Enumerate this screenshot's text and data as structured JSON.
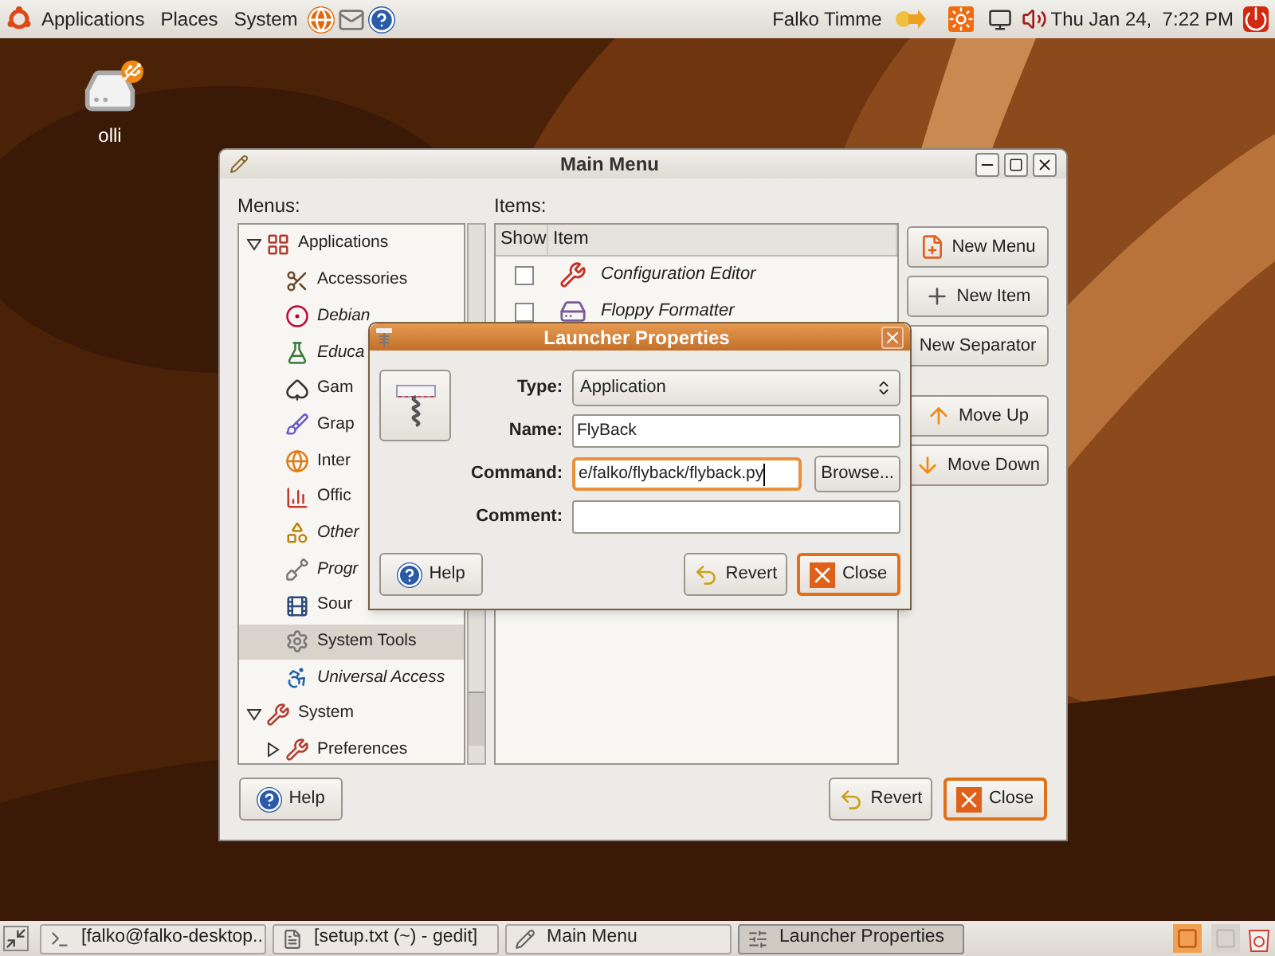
{
  "top_panel": {
    "menus": [
      {
        "label": "Applications"
      },
      {
        "label": "Places"
      },
      {
        "label": "System"
      }
    ],
    "user": "Falko Timme",
    "clock": "Thu Jan 24,  7:22 PM"
  },
  "desktop_icons": [
    {
      "label": "olli"
    }
  ],
  "main_menu": {
    "title": "Main Menu",
    "menus_label": "Menus:",
    "items_label": "Items:",
    "tree": [
      {
        "label": "Applications",
        "expanded": true,
        "selected": false,
        "hidden": false,
        "children": [
          {
            "label": "Accessories",
            "selected": false,
            "hidden": false
          },
          {
            "label": "Debian",
            "selected": false,
            "hidden": true
          },
          {
            "label": "Educa",
            "selected": false,
            "hidden": true
          },
          {
            "label": "Gam",
            "selected": false,
            "hidden": false
          },
          {
            "label": "Grap",
            "selected": false,
            "hidden": false
          },
          {
            "label": "Inter",
            "selected": false,
            "hidden": false
          },
          {
            "label": "Offic",
            "selected": false,
            "hidden": false
          },
          {
            "label": "Other",
            "selected": false,
            "hidden": true
          },
          {
            "label": "Progr",
            "selected": false,
            "hidden": true
          },
          {
            "label": "Sour",
            "selected": false,
            "hidden": false
          },
          {
            "label": "System Tools",
            "selected": true,
            "hidden": false
          },
          {
            "label": "Universal Access",
            "selected": false,
            "hidden": true
          }
        ]
      },
      {
        "label": "System",
        "expanded": true,
        "selected": false,
        "hidden": false,
        "children": [
          {
            "label": "Preferences",
            "expanded": false,
            "selected": false,
            "hidden": false
          }
        ]
      }
    ],
    "columns": [
      "Show",
      "Item"
    ],
    "items": [
      {
        "label": "Configuration Editor",
        "checked": false,
        "hidden": true
      },
      {
        "label": "Floppy Formatter",
        "checked": false,
        "hidden": true
      }
    ],
    "side_buttons": [
      {
        "label": "New Menu",
        "kind": "new-menu"
      },
      {
        "label": "New Item",
        "kind": "new-item"
      },
      {
        "label": "New Separator",
        "kind": "separator"
      },
      {
        "label": "Move Up",
        "kind": "up"
      },
      {
        "label": "Move Down",
        "kind": "down"
      }
    ],
    "buttons": [
      {
        "label": "Help",
        "kind": "help"
      },
      {
        "label": "Revert",
        "kind": "revert"
      },
      {
        "label": "Close",
        "kind": "close"
      }
    ]
  },
  "launcher": {
    "title": "Launcher Properties",
    "fields": [
      {
        "label": "Type:",
        "kind": "select",
        "value": "Application"
      },
      {
        "label": "Name:",
        "kind": "text",
        "value": "FlyBack",
        "focused": false
      },
      {
        "label": "Command:",
        "kind": "text",
        "value": "e/falko/flyback/flyback.py",
        "focused": true,
        "browse": "Browse..."
      },
      {
        "label": "Comment:",
        "kind": "text",
        "focused": false
      }
    ],
    "buttons": [
      {
        "label": "Help",
        "kind": "help"
      },
      {
        "label": "Revert",
        "kind": "revert"
      },
      {
        "label": "Close",
        "kind": "close"
      }
    ]
  },
  "taskbar": [
    {
      "label": "[falko@falko-desktop...",
      "kind": "terminal",
      "selected": false
    },
    {
      "label": "[setup.txt (~) - gedit]",
      "kind": "editor",
      "selected": false
    },
    {
      "label": "Main Menu",
      "kind": "menu",
      "selected": false
    },
    {
      "label": "Launcher Properties",
      "kind": "launcher",
      "selected": true
    }
  ]
}
